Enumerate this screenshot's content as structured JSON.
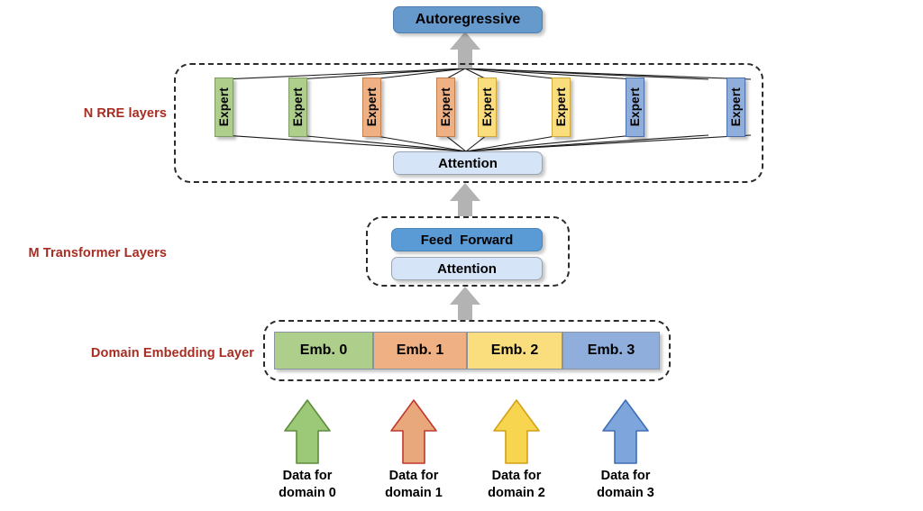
{
  "figure": {
    "type": "architecture-diagram",
    "title": "Mixture-of-Experts multi-domain model architecture"
  },
  "output": {
    "label": "Autoregressive",
    "color": "#6699CC"
  },
  "sections": [
    {
      "id": "rre",
      "label": "N RRE layers"
    },
    {
      "id": "transformer",
      "label": "M Transformer Layers"
    },
    {
      "id": "embedding",
      "label": "Domain Embedding Layer"
    }
  ],
  "rre_layer": {
    "label": "N RRE layers",
    "attention_label": "Attention",
    "attention_color": "#D6E4F7",
    "experts": [
      {
        "label": "Expert",
        "color": "#AECE8C",
        "border": "#7f9a63"
      },
      {
        "label": "Expert",
        "color": "#AECE8C",
        "border": "#7f9a63"
      },
      {
        "label": "Expert",
        "color": "#EFB183",
        "border": "#c07f4e"
      },
      {
        "label": "Expert",
        "color": "#EFB183",
        "border": "#c07f4e"
      },
      {
        "label": "Expert",
        "color": "#FADD7C",
        "border": "#cfa83c"
      },
      {
        "label": "Expert",
        "color": "#FADD7C",
        "border": "#cfa83c"
      },
      {
        "label": "Expert",
        "color": "#8FAEDB",
        "border": "#4a6fa8"
      },
      {
        "label": "Expert",
        "color": "#8FAEDB",
        "border": "#4a6fa8"
      }
    ]
  },
  "transformer_layer": {
    "label": "M Transformer Layers",
    "blocks": [
      {
        "label": "Feed  Forward",
        "color": "#5B9BD5"
      },
      {
        "label": "Attention",
        "color": "#D6E4F7"
      }
    ]
  },
  "embedding_layer": {
    "label": "Domain Embedding Layer",
    "cells": [
      {
        "label": "Emb. 0",
        "color": "#AECE8C"
      },
      {
        "label": "Emb. 1",
        "color": "#EFB183"
      },
      {
        "label": "Emb. 2",
        "color": "#FADD7C"
      },
      {
        "label": "Emb. 3",
        "color": "#8FAEDB"
      }
    ]
  },
  "inputs": [
    {
      "line1": "Data for",
      "line2": "domain 0",
      "fill": "#9CC978",
      "stroke": "#5E8C3C"
    },
    {
      "line1": "Data for",
      "line2": "domain 1",
      "fill": "#E8A87C",
      "stroke": "#C0392B"
    },
    {
      "line1": "Data for",
      "line2": "domain 2",
      "fill": "#F7D54E",
      "stroke": "#D4A017"
    },
    {
      "line1": "Data for",
      "line2": "domain 3",
      "fill": "#7FA6DC",
      "stroke": "#3E6FB5"
    }
  ],
  "colors": {
    "section_label": "#A72C22",
    "flow_arrow": "#B3B3B3",
    "dashed_border": "#2b2b2b",
    "connector_line": "#1a1a1a"
  }
}
